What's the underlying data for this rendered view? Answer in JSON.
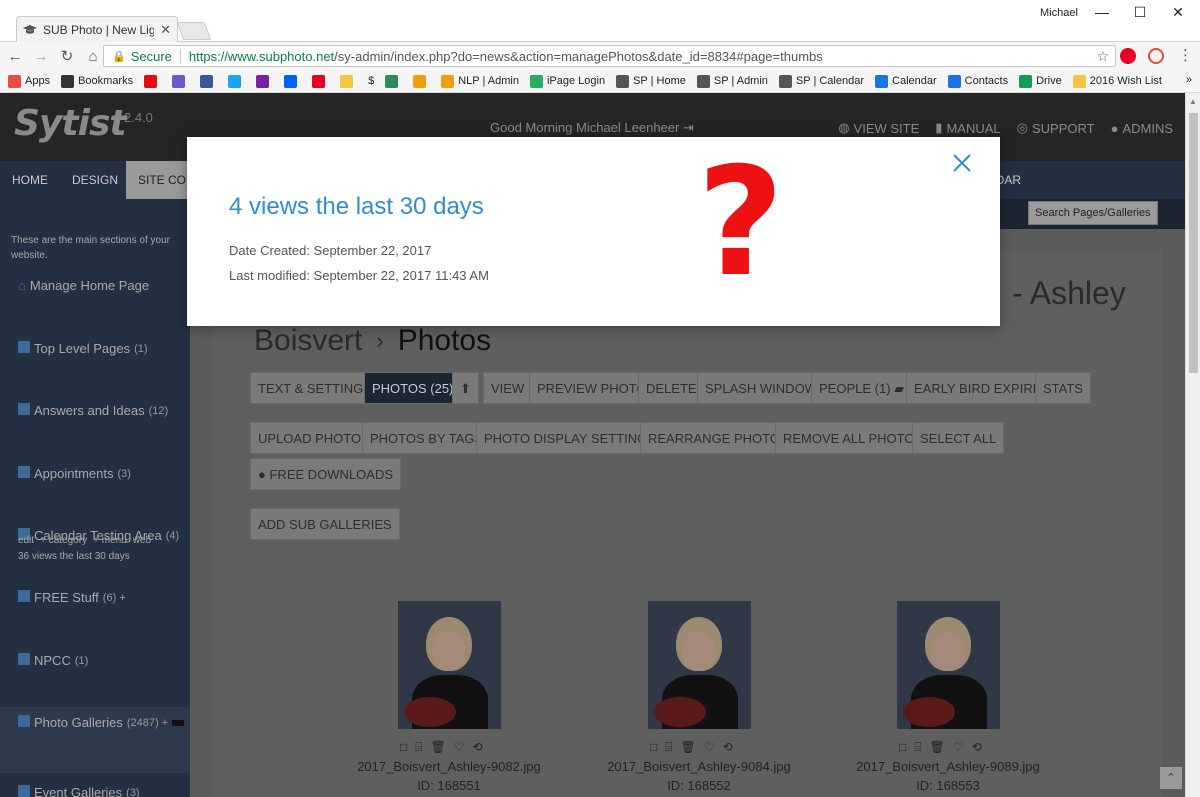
{
  "browser": {
    "tab_title": "SUB Photo | New Light P",
    "tab_close": "✕",
    "profile_name": "Michael",
    "win_min": "—",
    "win_max": "☐",
    "win_close": "✕",
    "secure_label": "Secure",
    "url_host": "https://www.subphoto.net",
    "url_path": "/sy-admin/index.php?do=news&action=managePhotos&date_id=8834#page=thumbs",
    "bookmarks": [
      {
        "label": "Apps",
        "icon": "apps-icon",
        "color": "#e74c3c"
      },
      {
        "label": "Bookmarks",
        "icon": "star-icon",
        "color": "#333333"
      },
      {
        "label": "",
        "icon": "netflix-icon",
        "color": "#e50914"
      },
      {
        "label": "",
        "icon": "k-icon",
        "color": "#6a5acd"
      },
      {
        "label": "",
        "icon": "facebook-icon",
        "color": "#3b5998"
      },
      {
        "label": "",
        "icon": "twitter-icon",
        "color": "#1da1f2"
      },
      {
        "label": "",
        "icon": "mail-icon",
        "color": "#7a1fa2"
      },
      {
        "label": "",
        "icon": "dropbox-icon",
        "color": "#0061ff"
      },
      {
        "label": "",
        "icon": "pinterest-icon",
        "color": "#e60023"
      },
      {
        "label": "",
        "icon": "folder-icon",
        "color": "#f4c542"
      },
      {
        "label": "$",
        "icon": "",
        "color": ""
      },
      {
        "label": "",
        "icon": "shield-icon",
        "color": "#2e8b57"
      },
      {
        "label": "",
        "icon": "sun-icon",
        "color": "#f39c12"
      },
      {
        "label": "NLP | Admin",
        "icon": "sun-icon",
        "color": "#f39c12"
      },
      {
        "label": "iPage Login",
        "icon": "ipage-icon",
        "color": "#27ae60"
      },
      {
        "label": "SP | Home",
        "icon": "graduation-icon",
        "color": "#555555"
      },
      {
        "label": "SP | Admin",
        "icon": "graduation-icon",
        "color": "#555555"
      },
      {
        "label": "SP | Calendar",
        "icon": "graduation-icon",
        "color": "#555555"
      },
      {
        "label": "Calendar",
        "icon": "calendar-icon",
        "color": "#1a73e8"
      },
      {
        "label": "Contacts",
        "icon": "contacts-icon",
        "color": "#1a73e8"
      },
      {
        "label": "Drive",
        "icon": "drive-icon",
        "color": "#0f9d58"
      },
      {
        "label": "2016 Wish List",
        "icon": "folder-icon",
        "color": "#f4c542"
      }
    ],
    "bookmarks_more": "»"
  },
  "app": {
    "logo": "Sytist",
    "version": "2.4.0",
    "greeting": "Good Morning Michael Leenheer",
    "top_links": [
      "VIEW SITE",
      "MANUAL",
      "SUPPORT",
      "ADMINS"
    ],
    "nav": [
      "HOME",
      "DESIGN",
      "SITE CON",
      "NDAR"
    ],
    "search_placeholder": "Search Pages/Galleries"
  },
  "sidebar": {
    "intro": "These are the main sections of your website.",
    "items": [
      {
        "label": "Manage Home Page",
        "count": ""
      },
      {
        "label": "Top Level Pages",
        "count": "(1)"
      },
      {
        "label": "Answers and Ideas",
        "count": "(12)"
      },
      {
        "label": "Appointments",
        "count": "(3)"
      },
      {
        "label": "Calendar Testing Area",
        "count": "(4)"
      },
      {
        "label": "FREE Stuff",
        "count": "(6) +"
      },
      {
        "label": "NPCC",
        "count": "(1)"
      },
      {
        "label": "Photo Galleries",
        "count": "(2487) +"
      },
      {
        "label": "Event Galleries",
        "count": "(3)"
      }
    ],
    "sub_links": [
      "edit",
      "+ category",
      "+ menu",
      "web"
    ],
    "views_note": "36 views the last 30 days"
  },
  "page": {
    "title_right": "- Ashley",
    "title_crumb": "Boisvert",
    "title_sep": "›",
    "title_last": "Photos",
    "tabs": [
      "TEXT & SETTINGS",
      "PHOTOS (25)",
      "⬆",
      "VIEW",
      "PREVIEW PHOTO",
      "DELETE",
      "SPLASH WINDOW",
      "PEOPLE (1)",
      "EARLY BIRD EXPIRED",
      "STATS"
    ],
    "actions": [
      "UPLOAD PHOTOS",
      "PHOTOS BY TAGS",
      "PHOTO DISPLAY SETTINGS",
      "REARRANGE PHOTOS",
      "REMOVE ALL PHOTOS",
      "SELECT ALL"
    ],
    "free_downloads": "FREE DOWNLOADS",
    "add_sub": "ADD SUB GALLERIES"
  },
  "photos": [
    {
      "name": "2017_Boisvert_Ashley-9082.jpg",
      "id": "ID: 168551"
    },
    {
      "name": "2017_Boisvert_Ashley-9084.jpg",
      "id": "ID: 168552"
    },
    {
      "name": "2017_Boisvert_Ashley-9089.jpg",
      "id": "ID: 168553"
    }
  ],
  "modal": {
    "title": "4 views the last 30 days",
    "date_created": "Date Created: September 22, 2017",
    "last_modified": "Last modified: September 22, 2017 11:43 AM",
    "annotation": "?"
  },
  "colors": {
    "accent": "#2f8fc6",
    "annotation": "#ee1111",
    "nav_bg": "#233041"
  }
}
